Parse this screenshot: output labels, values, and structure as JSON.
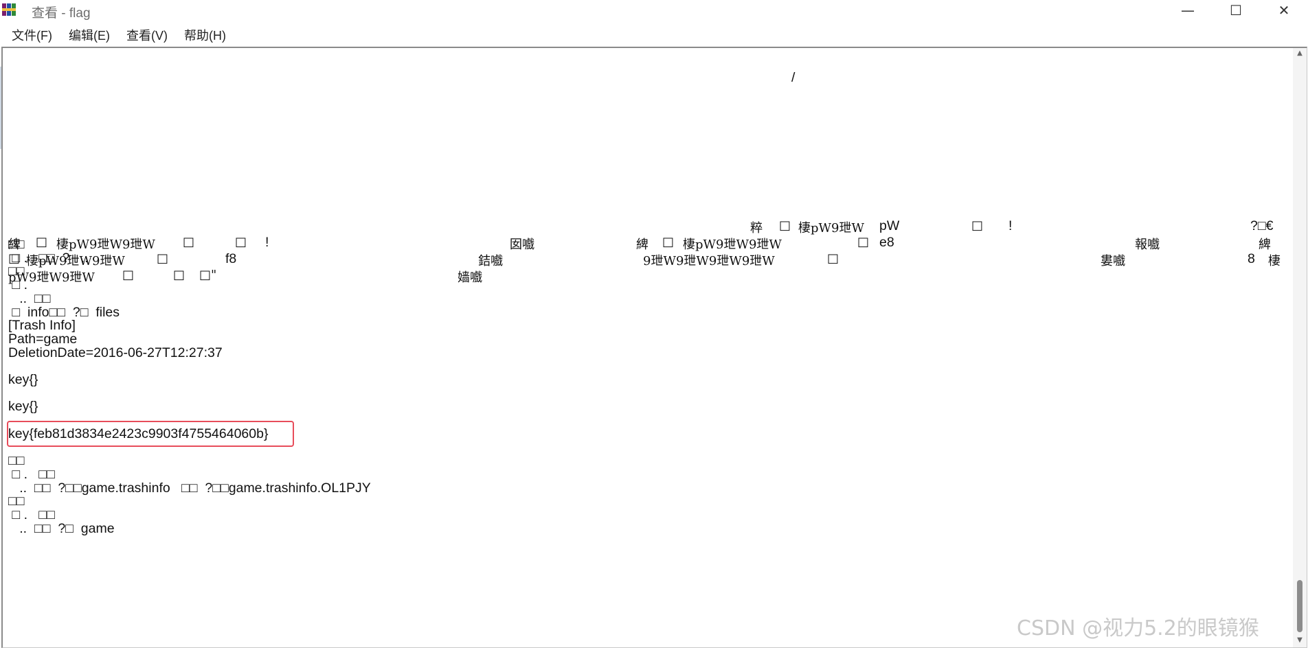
{
  "window": {
    "title": "查看 - flag",
    "icon": "winrar-books-icon",
    "controls": {
      "minimize": "—",
      "maximize": "☐",
      "close": "✕"
    }
  },
  "menu": [
    {
      "label": "文件(F)"
    },
    {
      "label": "编辑(E)"
    },
    {
      "label": "查看(V)"
    },
    {
      "label": "帮助(H)"
    }
  ],
  "content": {
    "slash": "/",
    "row1": [
      "粹",
      "□",
      "棲pW9玴W",
      "pW",
      "□",
      "!",
      "?□€"
    ],
    "row2": [
      "綼",
      "□",
      "棲pW9玴W9玴W",
      "□",
      "□",
      "!",
      "囡嚱",
      "綼",
      "□",
      "棲pW9玴W9玴W",
      "□",
      "e8",
      "報嚱",
      "綼"
    ],
    "row3": [
      "□",
      "棲pW9玴W9玴W",
      "□",
      "f8",
      "銡嚱",
      "9玴W9玴W9玴W9玴W",
      "□",
      "婁嚱",
      "8",
      "棲"
    ],
    "row4": [
      "pW9玴W9玴W",
      "□",
      "□",
      "□\"",
      "嫱嚱"
    ],
    "lines": [
      "□□",
      " □ .   □□  ?   ..",
      "□□",
      " □ .",
      "   ..  □□",
      " □  info□□  ?□  files",
      "[Trash Info]",
      "Path=game",
      "DeletionDate=2016-06-27T12:27:37",
      "",
      "key{}",
      "",
      "key{}",
      "",
      "key{feb81d3834e2423c9903f4755464060b}",
      "",
      "□□",
      " □ .   □□",
      "   ..  □□  ?□□game.trashinfo   □□  ?□□game.trashinfo.OL1PJY",
      "□□",
      " □ .   □□",
      "   ..  □□  ?□  game"
    ]
  },
  "watermark": "CSDN @视力5.2的眼镜猴"
}
